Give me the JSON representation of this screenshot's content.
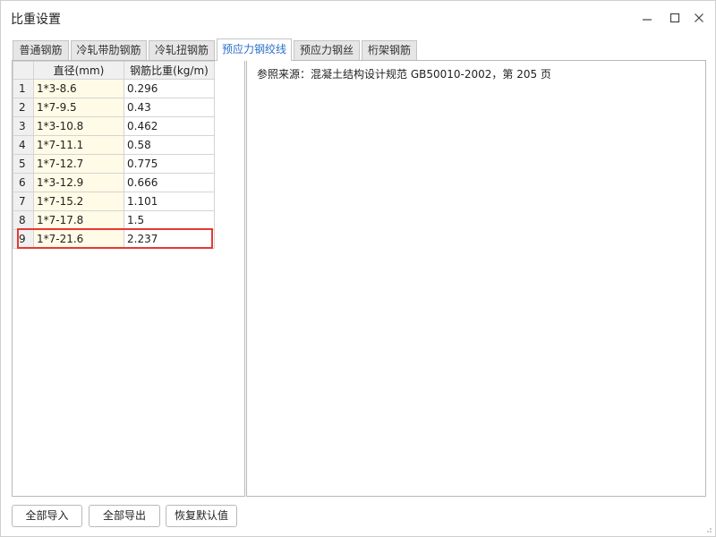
{
  "window": {
    "title": "比重设置",
    "minimize_glyph": "—",
    "close_glyph": "✕"
  },
  "tabs": [
    {
      "label": "普通钢筋",
      "active": false
    },
    {
      "label": "冷轧带肋钢筋",
      "active": false
    },
    {
      "label": "冷轧扭钢筋",
      "active": false
    },
    {
      "label": "预应力钢绞线",
      "active": true
    },
    {
      "label": "预应力钢丝",
      "active": false
    },
    {
      "label": "桁架钢筋",
      "active": false
    }
  ],
  "table": {
    "headers": {
      "index": "",
      "diameter": "直径(mm)",
      "weight": "钢筋比重(kg/m)"
    },
    "rows": [
      {
        "index": "1",
        "diameter": "1*3-8.6",
        "weight": "0.296"
      },
      {
        "index": "2",
        "diameter": "1*7-9.5",
        "weight": "0.43"
      },
      {
        "index": "3",
        "diameter": "1*3-10.8",
        "weight": "0.462"
      },
      {
        "index": "4",
        "diameter": "1*7-11.1",
        "weight": "0.58"
      },
      {
        "index": "5",
        "diameter": "1*7-12.7",
        "weight": "0.775"
      },
      {
        "index": "6",
        "diameter": "1*3-12.9",
        "weight": "0.666"
      },
      {
        "index": "7",
        "diameter": "1*7-15.2",
        "weight": "1.101"
      },
      {
        "index": "8",
        "diameter": "1*7-17.8",
        "weight": "1.5"
      },
      {
        "index": "9",
        "diameter": "1*7-21.6",
        "weight": "2.237"
      }
    ],
    "highlighted_row": "9"
  },
  "reference": {
    "text": "参照来源：混凝土结构设计规范 GB50010-2002，第 205 页"
  },
  "buttons": {
    "import_all": "全部导入",
    "export_all": "全部导出",
    "restore_default": "恢复默认值"
  },
  "colors": {
    "active_tab_text": "#2a6fc8",
    "highlight_border": "#e53935",
    "diameter_cell_bg": "#fffbe6"
  }
}
